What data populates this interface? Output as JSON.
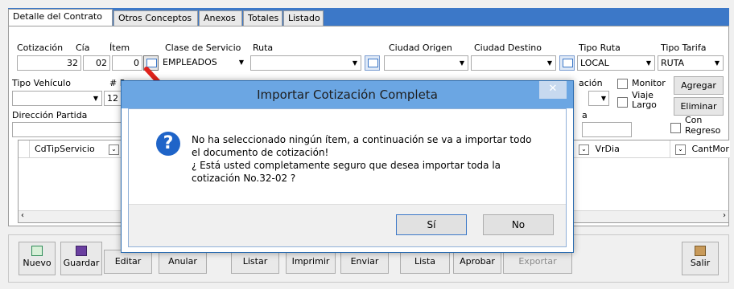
{
  "tabs": [
    "Detalle del Contrato",
    "Otros Conceptos",
    "Anexos",
    "Totales",
    "Listado"
  ],
  "form": {
    "cotizacion_label": "Cotización",
    "cotizacion_value": "32",
    "cia_label": "Cía",
    "cia_value": "02",
    "item_label": "Ítem",
    "item_value": "0",
    "clase_servicio_label": "Clase de Servicio",
    "clase_servicio_value": "EMPLEADOS",
    "ruta_label": "Ruta",
    "ruta_value": "",
    "ciudad_origen_label": "Ciudad Origen",
    "ciudad_destino_label": "Ciudad Destino",
    "tipo_ruta_label": "Tipo Ruta",
    "tipo_ruta_value": "LOCAL",
    "tipo_tarifa_label": "Tipo Tarifa",
    "tipo_tarifa_value": "RUTA",
    "tipo_vehiculo_label": "Tipo Vehículo",
    "hash_label": "# Pa",
    "row2_value": "12",
    "row2_partial_label": "ación",
    "direccion_partida_label": "Dirección Partida",
    "right_partial": "a",
    "monitor_label": "Monitor",
    "viaje_largo_label": "Viaje Largo",
    "con_regreso_label": "Con Regreso",
    "agregar_button": "Agregar",
    "eliminar_button": "Eliminar"
  },
  "grid": {
    "columns": [
      "CdTipServicio",
      "VrDia",
      "CantMor"
    ]
  },
  "toolbar": {
    "nuevo": "Nuevo",
    "guardar": "Guardar",
    "editar": "Editar",
    "anular": "Anular",
    "listar": "Listar",
    "imprimir": "Imprimir",
    "enviar": "Enviar",
    "lista": "Lista",
    "aprobar": "Aprobar",
    "exportar": "Exportar",
    "salir": "Salir"
  },
  "dialog": {
    "title": "Importar Cotización Completa",
    "message_line1": "No ha seleccionado ningún ítem, a continuación se va a importar todo",
    "message_line2": "el documento de cotización!",
    "message_line3": "¿ Está usted completamente seguro que desea importar toda la",
    "message_line4": "cotización No.32-02 ?",
    "yes_button": "Sí",
    "no_button": "No"
  },
  "colors": {
    "tab_strip": "#3c78c8",
    "dialog_title": "#6ba6e3",
    "question_icon": "#1f64c8",
    "arrow": "#e0231c"
  }
}
